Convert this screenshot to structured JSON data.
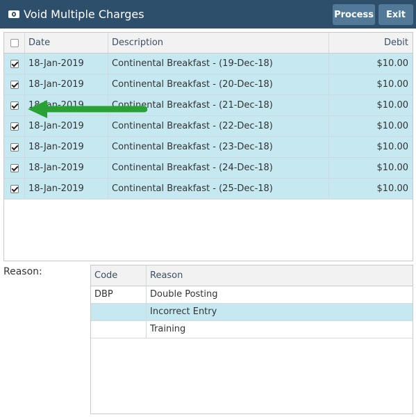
{
  "window": {
    "title": "Void Multiple Charges",
    "icon": "money-icon",
    "buttons": {
      "process": "Process",
      "exit": "Exit"
    }
  },
  "charges": {
    "columns": {
      "date": "Date",
      "description": "Description",
      "debit": "Debit"
    },
    "select_all_checked": false,
    "rows": [
      {
        "date": "18-Jan-2019",
        "description": "Continental Breakfast - (19-Dec-18)",
        "debit": "$10.00",
        "checked": true
      },
      {
        "date": "18-Jan-2019",
        "description": "Continental Breakfast - (20-Dec-18)",
        "debit": "$10.00",
        "checked": true
      },
      {
        "date": "18-Jan-2019",
        "description": "Continental Breakfast - (21-Dec-18)",
        "debit": "$10.00",
        "checked": true
      },
      {
        "date": "18-Jan-2019",
        "description": "Continental Breakfast - (22-Dec-18)",
        "debit": "$10.00",
        "checked": true
      },
      {
        "date": "18-Jan-2019",
        "description": "Continental Breakfast - (23-Dec-18)",
        "debit": "$10.00",
        "checked": true
      },
      {
        "date": "18-Jan-2019",
        "description": "Continental Breakfast - (24-Dec-18)",
        "debit": "$10.00",
        "checked": true
      },
      {
        "date": "18-Jan-2019",
        "description": "Continental Breakfast - (25-Dec-18)",
        "debit": "$10.00",
        "checked": true
      }
    ]
  },
  "reason": {
    "label": "Reason:",
    "columns": {
      "code": "Code",
      "reason": "Reason"
    },
    "rows": [
      {
        "code": "DBP",
        "reason": "Double Posting",
        "selected": false
      },
      {
        "code": "",
        "reason": "Incorrect Entry",
        "selected": true
      },
      {
        "code": "",
        "reason": "Training",
        "selected": false
      }
    ]
  },
  "colors": {
    "titlebar": "#2e4f6b",
    "button": "#537999",
    "selected_row": "#c6e9f1",
    "arrow": "#2aa135"
  }
}
